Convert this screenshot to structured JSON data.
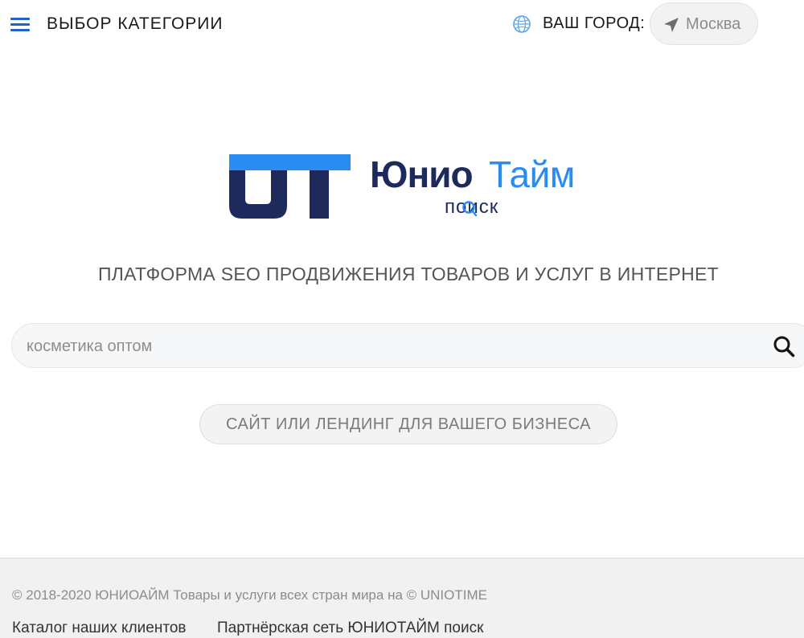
{
  "header": {
    "category_title": "ВЫБОР КАТЕГОРИИ",
    "city_label": "ВАШ ГОРОД:",
    "city_value": "Москва",
    "menu_icon": "hamburger-icon",
    "city_icon": "globe-icon",
    "location_icon": "navigation-arrow-icon"
  },
  "logo": {
    "brand_part1": "Юнио",
    "brand_part2": "Тайм",
    "subtitle": "поиск"
  },
  "main": {
    "slogan": "ПЛАТФОРМА SEO ПРОДВИЖЕНИЯ ТОВАРОВ И УСЛУГ В ИНТЕРНЕТ",
    "search_placeholder": "косметика оптом",
    "search_value": "",
    "business_button": "САЙТ ИЛИ ЛЕНДИНГ ДЛЯ ВАШЕГО БИЗНЕСА"
  },
  "footer": {
    "copyright": "© 2018-2020 ЮНИОАЙМ Товары и услуги всех стран мира на © UNIOTIME",
    "links": [
      "Каталог наших клиентов",
      "Партнёрская сеть ЮНИОТАЙМ поиск"
    ]
  },
  "colors": {
    "accent_blue": "#2a8bf0",
    "brand_navy": "#1f2a5c",
    "menu_blue": "#1e63c9"
  }
}
